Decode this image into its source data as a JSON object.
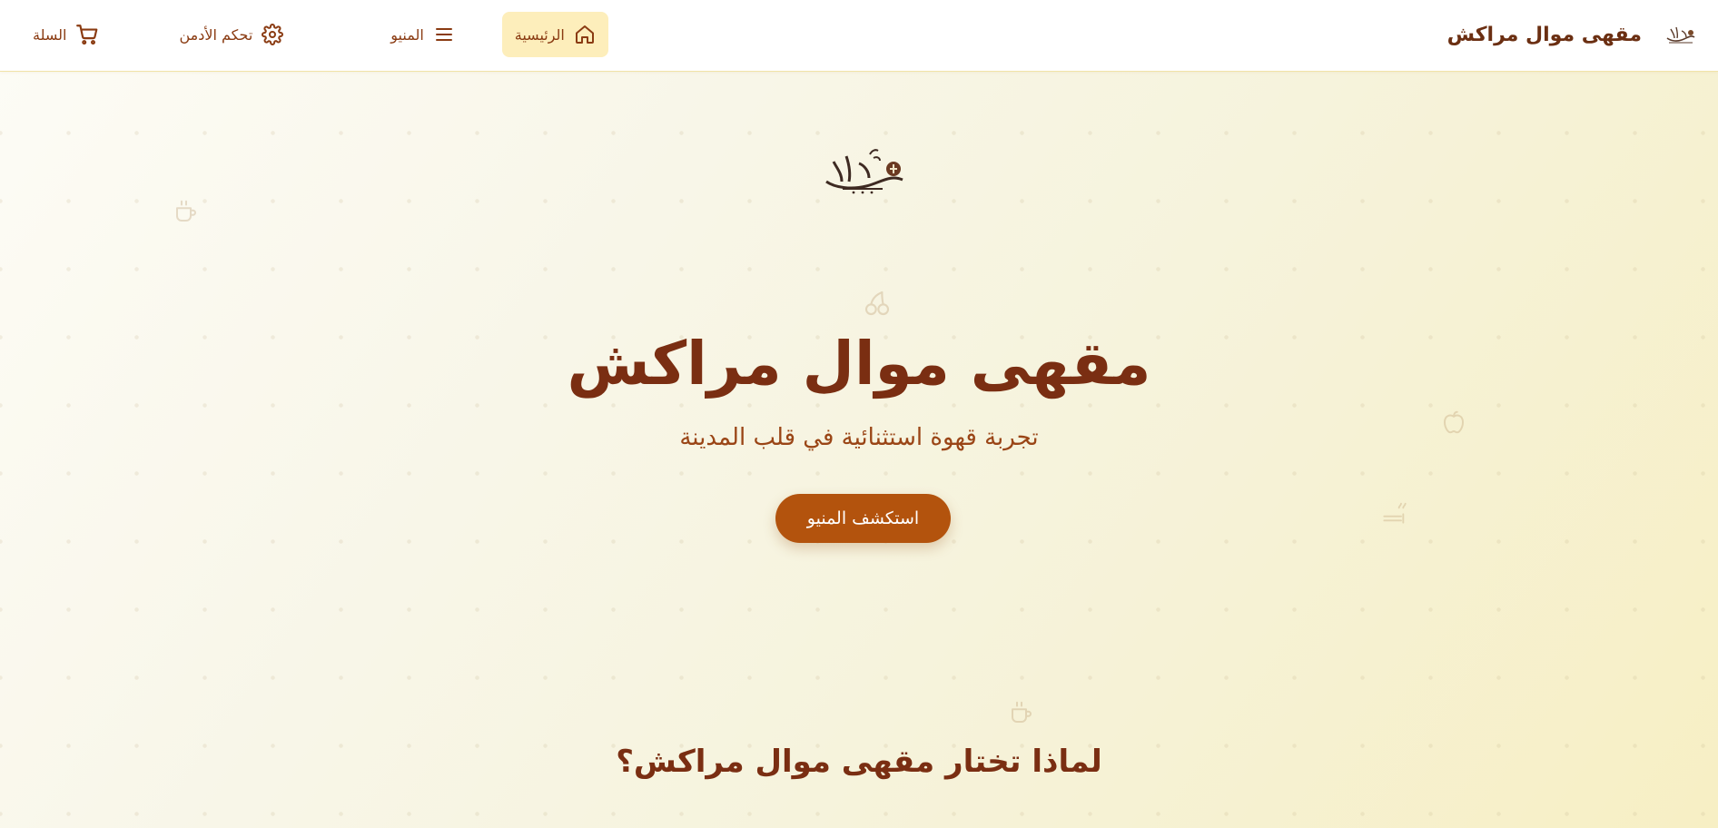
{
  "app": {
    "title": "مقهى موال مراكش"
  },
  "nav": {
    "home": "الرئيسية",
    "menu": "المنيو",
    "admin": "تحكم الأدمن",
    "cart": "السلة"
  },
  "hero": {
    "logo_text": "مقهى موال مراكش",
    "title": "مقهى موال مراكش",
    "subtitle": "تجربة قهوة استثنائية في قلب المدينة",
    "cta": "استكشف المنيو"
  },
  "features": {
    "title": "لماذا تختار مقهى موال مراكش؟"
  },
  "icons": {
    "home": "home-icon",
    "menu": "menu-icon",
    "admin": "gear-icon",
    "cart": "cart-icon",
    "deco": [
      "cup-icon",
      "cherry-icon",
      "apple-icon",
      "hookah-icon",
      "cup-icon"
    ]
  },
  "colors": {
    "brand": "#7a2e12",
    "accent": "#b3530d",
    "nav_active_bg": "#fdeebb",
    "background": "#f8f6e8"
  }
}
